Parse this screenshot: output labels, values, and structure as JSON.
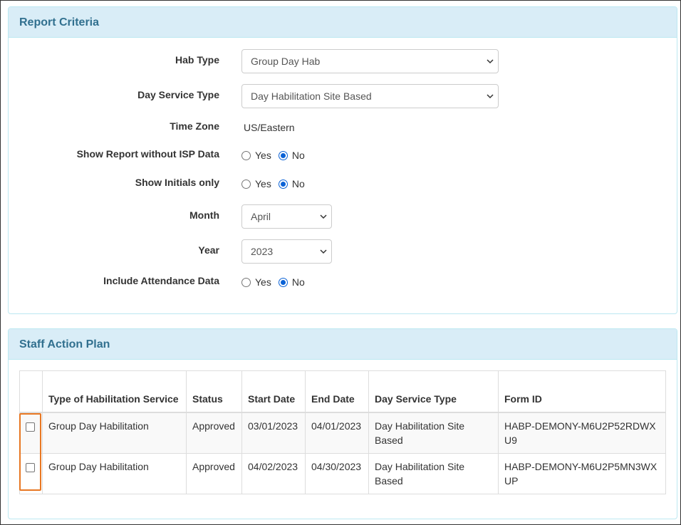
{
  "report_criteria": {
    "title": "Report Criteria",
    "fields": {
      "hab_type": {
        "label": "Hab Type",
        "value": "Group Day Hab"
      },
      "day_service_type": {
        "label": "Day Service Type",
        "value": "Day Habilitation Site Based"
      },
      "time_zone": {
        "label": "Time Zone",
        "value": "US/Eastern"
      },
      "show_without_isp": {
        "label": "Show Report without ISP Data",
        "yes": "Yes",
        "no": "No",
        "selected": "No"
      },
      "show_initials": {
        "label": "Show Initials only",
        "yes": "Yes",
        "no": "No",
        "selected": "No"
      },
      "month": {
        "label": "Month",
        "value": "April"
      },
      "year": {
        "label": "Year",
        "value": "2023"
      },
      "include_attendance": {
        "label": "Include Attendance Data",
        "yes": "Yes",
        "no": "No",
        "selected": "No"
      }
    }
  },
  "staff_action_plan": {
    "title": "Staff Action Plan",
    "columns": {
      "type": "Type of Habilitation Service",
      "status": "Status",
      "start": "Start Date",
      "end": "End Date",
      "day_service": "Day Service Type",
      "form_id": "Form ID"
    },
    "rows": [
      {
        "type": "Group Day Habilitation",
        "status": "Approved",
        "start": "03/01/2023",
        "end": "04/01/2023",
        "day_service": "Day Habilitation Site Based",
        "form_id": "HABP-DEMONY-M6U2P52RDWXU9"
      },
      {
        "type": "Group Day Habilitation",
        "status": "Approved",
        "start": "04/02/2023",
        "end": "04/30/2023",
        "day_service": "Day Habilitation Site Based",
        "form_id": "HABP-DEMONY-M6U2P5MN3WXUP"
      }
    ]
  },
  "icons": {
    "dropdown": "chevron-down-icon",
    "checkbox": "checkbox-icon",
    "radio": "radio-icon"
  },
  "colors": {
    "panel_heading_bg": "#d9edf7",
    "panel_heading_text": "#31708f",
    "highlight": "#e87722",
    "radio_checked": "#0b62d6"
  }
}
